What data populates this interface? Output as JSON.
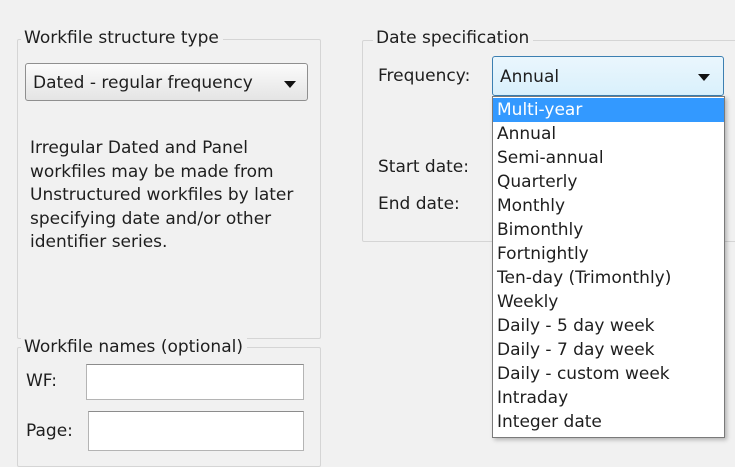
{
  "structure": {
    "legend": "Workfile structure type",
    "selected": "Dated - regular frequency",
    "note_lines": [
      "Irregular Dated and Panel",
      "workfiles may be made from",
      "Unstructured workfiles by later",
      "specifying date and/or other",
      "identifier series."
    ]
  },
  "date_spec": {
    "legend": "Date specification",
    "frequency_label": "Frequency:",
    "frequency_value": "Annual",
    "start_label": "Start date:",
    "end_label": "End date:"
  },
  "names": {
    "legend": "Workfile names (optional)",
    "wf_label": "WF:",
    "page_label": "Page:"
  },
  "frequency_options": [
    "Multi-year",
    "Annual",
    "Semi-annual",
    "Quarterly",
    "Monthly",
    "Bimonthly",
    "Fortnightly",
    "Ten-day (Trimonthly)",
    "Weekly",
    "Daily - 5 day week",
    "Daily - 7 day week",
    "Daily - custom week",
    "Intraday",
    "Integer date"
  ],
  "highlighted_option": "Multi-year",
  "colors": {
    "highlight": "#3399ff",
    "focus_border": "#3c7fb1"
  }
}
